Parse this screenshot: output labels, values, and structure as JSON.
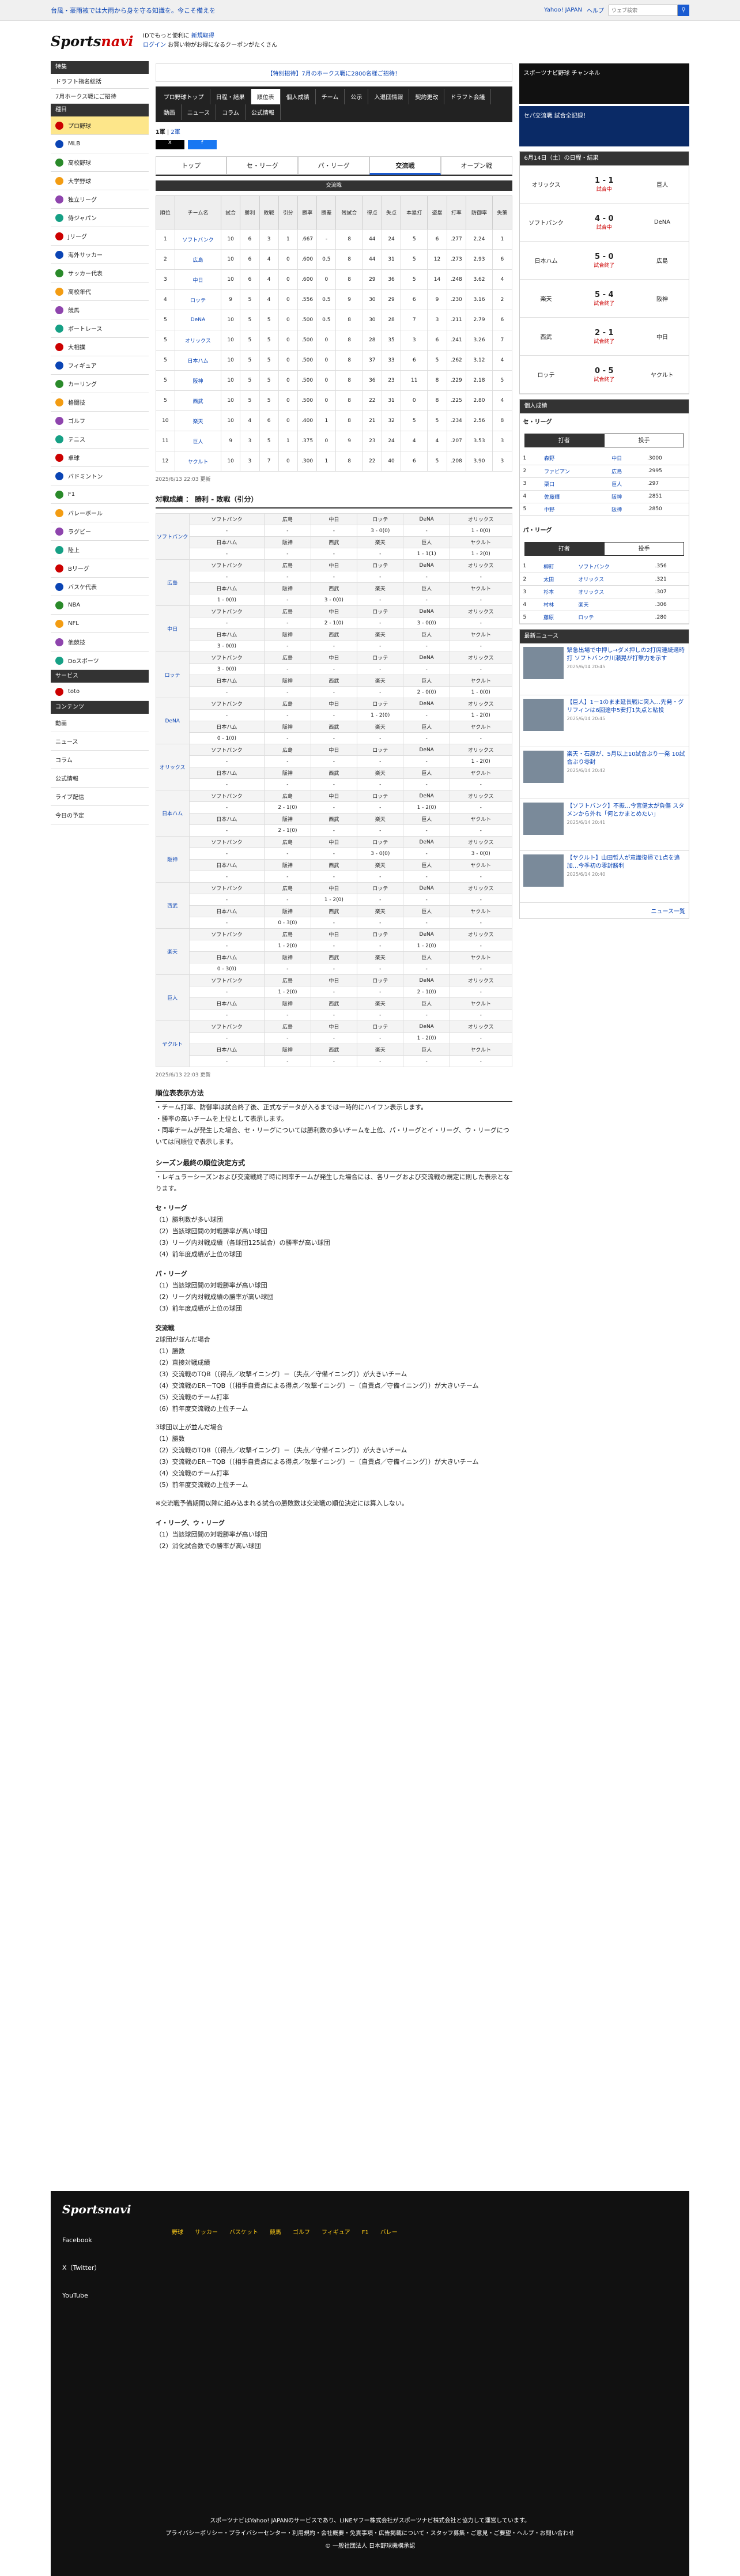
{
  "topbar": {
    "message": "台風・豪雨被では大雨から身を守る知識を。今こそ備えを",
    "links": [
      "Yahoo! JAPAN",
      "ヘルプ"
    ],
    "search_placeholder": "ウェブ検索"
  },
  "header": {
    "line1": "IDでもっと便利に",
    "line1_link": "新規取得",
    "line2": "ログイン",
    "line3": "お買い物がお得になるクーポンがたくさん"
  },
  "sidebar": {
    "groups": [
      {
        "title": "特集",
        "items": [
          "ドラフト指名総括",
          "7月ホークス戦にご招待"
        ]
      },
      {
        "title": "種目",
        "items": [
          "プロ野球",
          "MLB",
          "高校野球",
          "大学野球",
          "独立リーグ",
          "侍ジャパン",
          "Jリーグ",
          "海外サッカー",
          "サッカー代表",
          "高校年代",
          "競馬",
          "ボートレース",
          "大相撲",
          "フィギュア",
          "カーリング",
          "格闘技",
          "ゴルフ",
          "テニス",
          "卓球",
          "バドミントン",
          "F1",
          "バレーボール",
          "ラグビー",
          "陸上",
          "Bリーグ",
          "バスケ代表",
          "NBA",
          "NFL",
          "他競技",
          "Doスポーツ"
        ]
      },
      {
        "title": "サービス",
        "items": [
          "toto"
        ]
      },
      {
        "title": "コンテンツ",
        "items": [
          "動画",
          "ニュース",
          "コラム",
          "公式情報",
          "ライブ配信",
          "今日の予定"
        ]
      }
    ]
  },
  "banner": "【特別招待】7月のホークス戦に2800名様ご招待！",
  "tabs": [
    "プロ野球トップ",
    "日程・結果",
    "順位表",
    "個人成績",
    "チーム",
    "公示",
    "入退団情報",
    "契約更改",
    "ドラフト会議",
    "動画",
    "ニュース",
    "コラム",
    "公式情報"
  ],
  "tab_active": "順位表",
  "pager": [
    "1軍",
    "2軍"
  ],
  "period_tabs": [
    "トップ",
    "セ・リーグ",
    "パ・リーグ",
    "交流戦",
    "オープン戦"
  ],
  "period_active": "交流戦",
  "standings": {
    "caption": "交流戦",
    "headers": [
      "順位",
      "チーム名",
      "試合",
      "勝利",
      "敗戦",
      "引分",
      "勝率",
      "勝差",
      "残試合",
      "得点",
      "失点",
      "本塁打",
      "盗塁",
      "打率",
      "防御率",
      "失策"
    ],
    "rows": [
      [
        "1",
        "ソフトバンク",
        "10",
        "6",
        "3",
        "1",
        ".667",
        "-",
        "8",
        "44",
        "24",
        "5",
        "6",
        ".277",
        "2.24",
        "1"
      ],
      [
        "2",
        "広島",
        "10",
        "6",
        "4",
        "0",
        ".600",
        "0.5",
        "8",
        "44",
        "31",
        "5",
        "12",
        ".273",
        "2.93",
        "6"
      ],
      [
        "3",
        "中日",
        "10",
        "6",
        "4",
        "0",
        ".600",
        "0",
        "8",
        "29",
        "36",
        "5",
        "14",
        ".248",
        "3.62",
        "4"
      ],
      [
        "4",
        "ロッテ",
        "9",
        "5",
        "4",
        "0",
        ".556",
        "0.5",
        "9",
        "30",
        "29",
        "6",
        "9",
        ".230",
        "3.16",
        "2"
      ],
      [
        "5",
        "DeNA",
        "10",
        "5",
        "5",
        "0",
        ".500",
        "0.5",
        "8",
        "30",
        "28",
        "7",
        "3",
        ".211",
        "2.79",
        "6"
      ],
      [
        "5",
        "オリックス",
        "10",
        "5",
        "5",
        "0",
        ".500",
        "0",
        "8",
        "28",
        "35",
        "3",
        "6",
        ".241",
        "3.26",
        "7"
      ],
      [
        "5",
        "日本ハム",
        "10",
        "5",
        "5",
        "0",
        ".500",
        "0",
        "8",
        "37",
        "33",
        "6",
        "5",
        ".262",
        "3.12",
        "4"
      ],
      [
        "5",
        "阪神",
        "10",
        "5",
        "5",
        "0",
        ".500",
        "0",
        "8",
        "36",
        "23",
        "11",
        "8",
        ".229",
        "2.18",
        "5"
      ],
      [
        "5",
        "西武",
        "10",
        "5",
        "5",
        "0",
        ".500",
        "0",
        "8",
        "22",
        "31",
        "0",
        "8",
        ".225",
        "2.80",
        "4"
      ],
      [
        "10",
        "楽天",
        "10",
        "4",
        "6",
        "0",
        ".400",
        "1",
        "8",
        "21",
        "32",
        "5",
        "5",
        ".234",
        "2.56",
        "8"
      ],
      [
        "11",
        "巨人",
        "9",
        "3",
        "5",
        "1",
        ".375",
        "0",
        "9",
        "23",
        "24",
        "4",
        "4",
        ".207",
        "3.53",
        "3"
      ],
      [
        "12",
        "ヤクルト",
        "10",
        "3",
        "7",
        "0",
        ".300",
        "1",
        "8",
        "22",
        "40",
        "6",
        "5",
        ".208",
        "3.90",
        "3"
      ]
    ],
    "updated": "2025/6/13 22:03 更新"
  },
  "matchup": {
    "title": "対戦成績 ： 勝利 - 敗戦（引分）",
    "teams": [
      "ソフトバンク",
      "広島",
      "中日",
      "ロッテ",
      "DeNA",
      "オリックス",
      "日本ハム",
      "阪神",
      "西武",
      "楽天",
      "巨人",
      "ヤクルト"
    ],
    "head1": [
      "ソフトバンク",
      "広島",
      "中日",
      "ロッテ",
      "DeNA",
      "オリックス"
    ],
    "head2": [
      "日本ハム",
      "阪神",
      "西武",
      "楽天",
      "巨人",
      "ヤクルト"
    ],
    "rows1": [
      [
        "-",
        "-",
        "-",
        "3 - 0(0)",
        "-",
        "1 - 0(0)"
      ],
      [
        "-",
        "-",
        "-",
        "-",
        "-",
        "-"
      ],
      [
        "-",
        "-",
        "2 - 1(0)",
        "-",
        "3 - 0(0)",
        "-"
      ],
      [
        "3 - 0(0)",
        "-",
        "-",
        "-",
        "-",
        "-"
      ],
      [
        "-",
        "-",
        "-",
        "1 - 2(0)",
        "-",
        "1 - 2(0)"
      ],
      [
        "-",
        "-",
        "-",
        "-",
        "-",
        "1 - 2(0)"
      ],
      [
        "-",
        "2 - 1(0)",
        "-",
        "-",
        "1 - 2(0)",
        "-"
      ],
      [
        "-",
        "-",
        "-",
        "3 - 0(0)",
        "-",
        "3 - 0(0)"
      ],
      [
        "-",
        "-",
        "1 - 2(0)",
        "-",
        "-",
        "-"
      ],
      [
        "-",
        "1 - 2(0)",
        "-",
        "-",
        "1 - 2(0)",
        "-"
      ],
      [
        "-",
        "1 - 2(0)",
        "-",
        "-",
        "2 - 1(0)",
        "-"
      ],
      [
        "-",
        "-",
        "-",
        "-",
        "1 - 2(0)",
        "-"
      ]
    ],
    "rows2": [
      [
        "-",
        "-",
        "-",
        "-",
        "1 - 1(1)",
        "1 - 2(0)"
      ],
      [
        "1 - 0(0)",
        "-",
        "3 - 0(0)",
        "-",
        "-",
        "-"
      ],
      [
        "3 - 0(0)",
        "-",
        "-",
        "-",
        "-",
        "-"
      ],
      [
        "-",
        "-",
        "-",
        "-",
        "2 - 0(0)",
        "1 - 0(0)"
      ],
      [
        "0 - 1(0)",
        "-",
        "-",
        "-",
        "-",
        "-"
      ],
      [
        "-",
        "-",
        "-",
        "-",
        "-",
        "-"
      ],
      [
        "-",
        "2 - 1(0)",
        "-",
        "-",
        "-",
        "-"
      ],
      [
        "-",
        "-",
        "-",
        "-",
        "-",
        "-"
      ],
      [
        "-",
        "0 - 3(0)",
        "-",
        "-",
        "-",
        "-"
      ],
      [
        "0 - 3(0)",
        "-",
        "-",
        "-",
        "-",
        "-"
      ],
      [
        "-",
        "-",
        "-",
        "-",
        "-",
        "-"
      ],
      [
        "-",
        "-",
        "-",
        "-",
        "-",
        "-"
      ]
    ],
    "updated": "2025/6/13 22:03 更新"
  },
  "rules": {
    "title": "順位表表示方法",
    "bullets": [
      "・チーム打率、防御率は試合終了後、正式なデータが入るまでは一時的にハイフン表示します。",
      "・勝率の高いチームを上位として表示します。",
      "・同率チームが発生した場合、セ・リーグについては勝利数の多いチームを上位、パ・リーグとイ・リーグ、ウ・リーグについては同順位で表示します。"
    ],
    "title2": "シーズン最終の順位決定方式",
    "p2": "・レギュラーシーズンおよび交流戦終了時に同率チームが発生した場合には、各リーグおよび交流戦の規定に則した表示となります。",
    "se_title": "セ・リーグ",
    "se": [
      "（1）勝利数が多い球団",
      "（2）当該球団間の対戦勝率が高い球団",
      "（3）リーグ内対戦成績（各球団125試合）の勝率が高い球団",
      "（4）前年度成績が上位の球団"
    ],
    "pa_title": "パ・リーグ",
    "pa": [
      "（1）当該球団間の対戦勝率が高い球団",
      "（2）リーグ内対戦成績の勝率が高い球団",
      "（3）前年度成績が上位の球団"
    ],
    "kr_title": "交流戦",
    "kr": [
      "2球団が並んだ場合",
      "（1）勝数",
      "（2）直接対戦成績",
      "（3）交流戦のTQB（〔得点／攻撃イニング〕－〔失点／守備イニング〕）が大きいチーム",
      "（4）交流戦のER－TQB（〔相手自責点による得点／攻撃イニング〕－〔自責点／守備イニング〕）が大きいチーム",
      "（5）交流戦のチーム打率",
      "（6）前年度交流戦の上位チーム",
      "",
      "3球団以上が並んだ場合",
      "（1）勝数",
      "（2）交流戦のTQB（〔得点／攻撃イニング〕－〔失点／守備イニング〕）が大きいチーム",
      "（3）交流戦のER－TQB（〔相手自責点による得点／攻撃イニング〕－〔自責点／守備イニング〕）が大きいチーム",
      "（4）交流戦のチーム打率",
      "（5）前年度交流戦の上位チーム",
      "",
      "※交流戦予備期間以降に組み込まれる試合の勝敗数は交流戦の順位決定には算入しない。"
    ],
    "il_title": "イ・リーグ、ウ・リーグ",
    "il": [
      "（1）当該球団間の対戦勝率が高い球団",
      "（2）消化試合数での勝率が高い球団"
    ]
  },
  "right": {
    "ad1": "スポーツナビ野球 チャンネル",
    "ad2": "セパ交流戦 試合全記録！",
    "results_title": "6月14日（土）の日程・結果",
    "games": [
      [
        "オリックス",
        "1 - 1",
        "巨人",
        "試合中"
      ],
      [
        "ソフトバンク",
        "4 - 0",
        "DeNA",
        "試合中"
      ],
      [
        "日本ハム",
        "5 - 0",
        "広島",
        "試合終了"
      ],
      [
        "楽天",
        "5 - 4",
        "阪神",
        "試合終了"
      ],
      [
        "西武",
        "2 - 1",
        "中日",
        "試合終了"
      ],
      [
        "ロッテ",
        "0 - 5",
        "ヤクルト",
        "試合終了"
      ]
    ],
    "indiv_title": "個人成績",
    "se_title": "セ・リーグ",
    "seg": [
      "打者",
      "投手"
    ],
    "se_rows": [
      [
        "1",
        "森野",
        "中日",
        ".3000"
      ],
      [
        "2",
        "ファビアン",
        "広島",
        ".2995"
      ],
      [
        "3",
        "栗口",
        "巨人",
        ".297"
      ],
      [
        "4",
        "佐藤輝",
        "阪神",
        ".2851"
      ],
      [
        "5",
        "中野",
        "阪神",
        ".2850"
      ]
    ],
    "pa_title": "パ・リーグ",
    "pa_rows": [
      [
        "1",
        "柳町",
        "ソフトバンク",
        ".356"
      ],
      [
        "2",
        "太田",
        "オリックス",
        ".321"
      ],
      [
        "3",
        "杉本",
        "オリックス",
        ".307"
      ],
      [
        "4",
        "村林",
        "楽天",
        ".306"
      ],
      [
        "5",
        "藤原",
        "ロッテ",
        ".280"
      ]
    ],
    "news_title": "最新ニュース",
    "news": [
      [
        "緊急出場で中押し→ダメ押しの2打席連続適時打 ソフトバンク川瀬晃が打撃力を示す",
        "2025/6/14 20:45"
      ],
      [
        "【巨人】1－1のまま延長戦に突入…先発・グリフィンは6回途中5安打1失点と粘投",
        "2025/6/14 20:45"
      ],
      [
        "楽天・石原が、5月以上10試合ぶり一発 10試合ぶり零封",
        "2025/6/14 20:42"
      ],
      [
        "【ソフトバンク】不振…今宮健太が負傷 スタメンから外れ「何とかまとめたい」",
        "2025/6/14 20:41"
      ],
      [
        "【ヤクルト】山田哲人が意識復帰で1点を追加…今季初の零封勝利",
        "2025/6/14 20:40"
      ]
    ],
    "news_more": "ニュース一覧"
  },
  "footer": {
    "logo": "Sportsnavi",
    "sns": [
      "Facebook",
      "X（Twitter）",
      "YouTube"
    ],
    "cols": [
      "野球",
      "サッカー",
      "バスケット",
      "競馬",
      "ゴルフ",
      "フィギュア",
      "F1",
      "バレー"
    ],
    "copyright": "スポーツナビはYahoo! JAPANのサービスであり、LINEヤフー株式会社がスポーツナビ株式会社と協力して運営しています。",
    "links": "プライバシーポリシー・プライバシーセンター・利用規約・会社概要・免責事項・広告掲載について・スタッフ募集・ご意見・ご要望・ヘルプ・お問い合わせ",
    "copy": "© 一般社団法人 日本野球機構承認"
  }
}
